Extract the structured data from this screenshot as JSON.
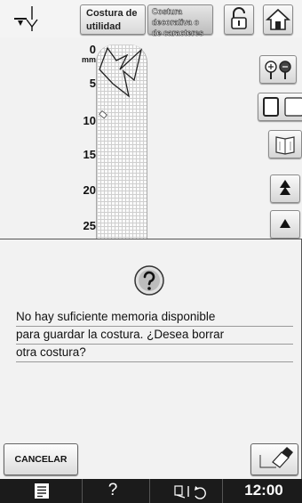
{
  "toolbar": {
    "utility_tab_label_1": "Costura de",
    "utility_tab_label_2": "utilidad",
    "decorative_tab_label_1": "Costura",
    "decorative_tab_label_2": "decorativa o",
    "decorative_tab_label_3": "de caracteres",
    "icons": [
      "needle-position-icon",
      "lock-icon",
      "home-icon"
    ]
  },
  "ruler": {
    "unit": "mm",
    "ticks": [
      "0",
      "5",
      "10",
      "15",
      "20",
      "25"
    ]
  },
  "side_controls": {
    "icons": [
      "zoom-icon",
      "frame-icon",
      "book-icon",
      "double-up-arrow-icon",
      "up-arrow-icon"
    ]
  },
  "dialog": {
    "icon": "question-icon",
    "message_lines": [
      "No hay suficiente memoria disponible",
      "para guardar la costura. ¿Desea borrar",
      "otra costura?"
    ],
    "cancel_label": "CANCELAR",
    "erase_icon": "eraser-icon"
  },
  "statusbar": {
    "help": "?",
    "time": "12:00",
    "icons": [
      "document-icon",
      "presser-foot-icon"
    ]
  }
}
